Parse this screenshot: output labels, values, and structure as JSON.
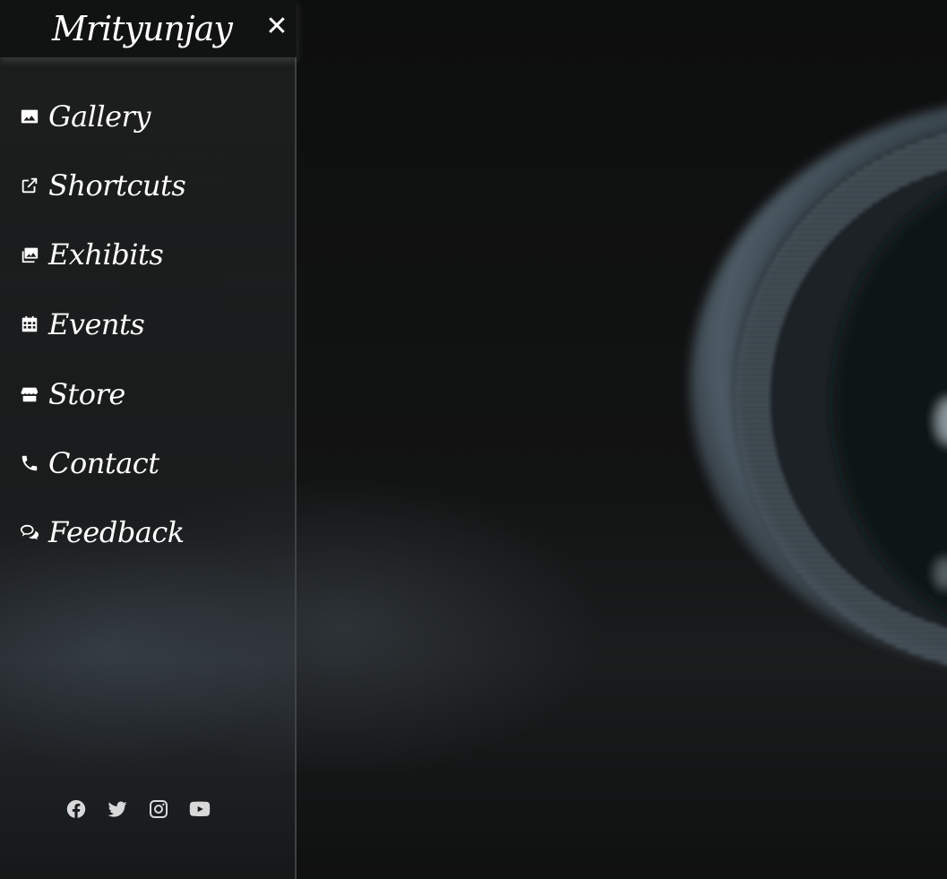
{
  "sidebar": {
    "brand": "Mrityunjay",
    "close_label": "✕",
    "items": [
      {
        "label": "Gallery",
        "icon": "image-icon"
      },
      {
        "label": "Shortcuts",
        "icon": "external-link-icon"
      },
      {
        "label": "Exhibits",
        "icon": "photo-library-icon"
      },
      {
        "label": "Events",
        "icon": "calendar-icon"
      },
      {
        "label": "Store",
        "icon": "store-icon"
      },
      {
        "label": "Contact",
        "icon": "phone-icon"
      },
      {
        "label": "Feedback",
        "icon": "chat-bubbles-icon"
      }
    ],
    "social": [
      {
        "icon": "facebook-icon"
      },
      {
        "icon": "twitter-icon"
      },
      {
        "icon": "instagram-icon"
      },
      {
        "icon": "youtube-icon"
      }
    ]
  },
  "colors": {
    "background": "#0b0c0c",
    "text": "#ffffff",
    "social_icon": "#d8d8d8"
  }
}
